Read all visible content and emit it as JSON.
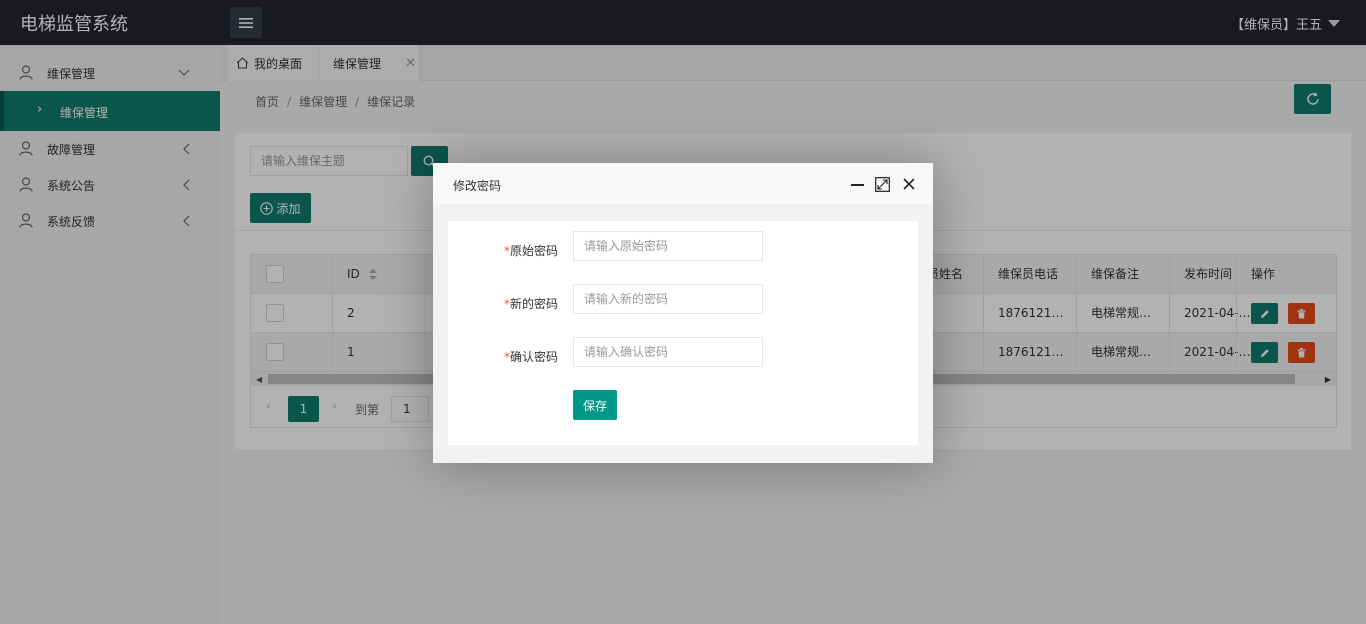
{
  "app": {
    "title": "电梯监管系统"
  },
  "header": {
    "user": "【维保员】王五"
  },
  "sidebar": {
    "items": [
      {
        "label": "维保管理",
        "expanded": true
      },
      {
        "label": "故障管理"
      },
      {
        "label": "系统公告"
      },
      {
        "label": "系统反馈"
      }
    ],
    "sub_active": "维保管理"
  },
  "tabs": [
    {
      "label": "我的桌面",
      "icon": "home-icon"
    },
    {
      "label": "维保管理",
      "active": true
    }
  ],
  "breadcrumb": {
    "home": "首页",
    "section": "维保管理",
    "current": "维保记录"
  },
  "toolbar": {
    "search_placeholder": "请输入维保主题",
    "add_label": "添加"
  },
  "table": {
    "columns": {
      "id": "ID",
      "name": "员姓名",
      "phone": "维保员电话",
      "note": "维保备注",
      "time": "发布时间",
      "ops": "操作"
    },
    "rows": [
      {
        "id": "2",
        "phone": "1876121…",
        "note": "电梯常规…",
        "time": "2021-04-…"
      },
      {
        "id": "1",
        "phone": "1876121…",
        "note": "电梯常规…",
        "time": "2021-04-…"
      }
    ]
  },
  "pager": {
    "current": "1",
    "goto_label": "到第",
    "goto_value": "1"
  },
  "modal": {
    "title": "修改密码",
    "fields": [
      {
        "label": "原始密码",
        "placeholder": "请输入原始密码"
      },
      {
        "label": "新的密码",
        "placeholder": "请输入新的密码"
      },
      {
        "label": "确认密码",
        "placeholder": "请输入确认密码"
      }
    ],
    "required_mark": "*",
    "save_label": "保存"
  },
  "colors": {
    "primary": "#0f7b6f",
    "danger": "#e64a19",
    "header": "#23262e"
  }
}
